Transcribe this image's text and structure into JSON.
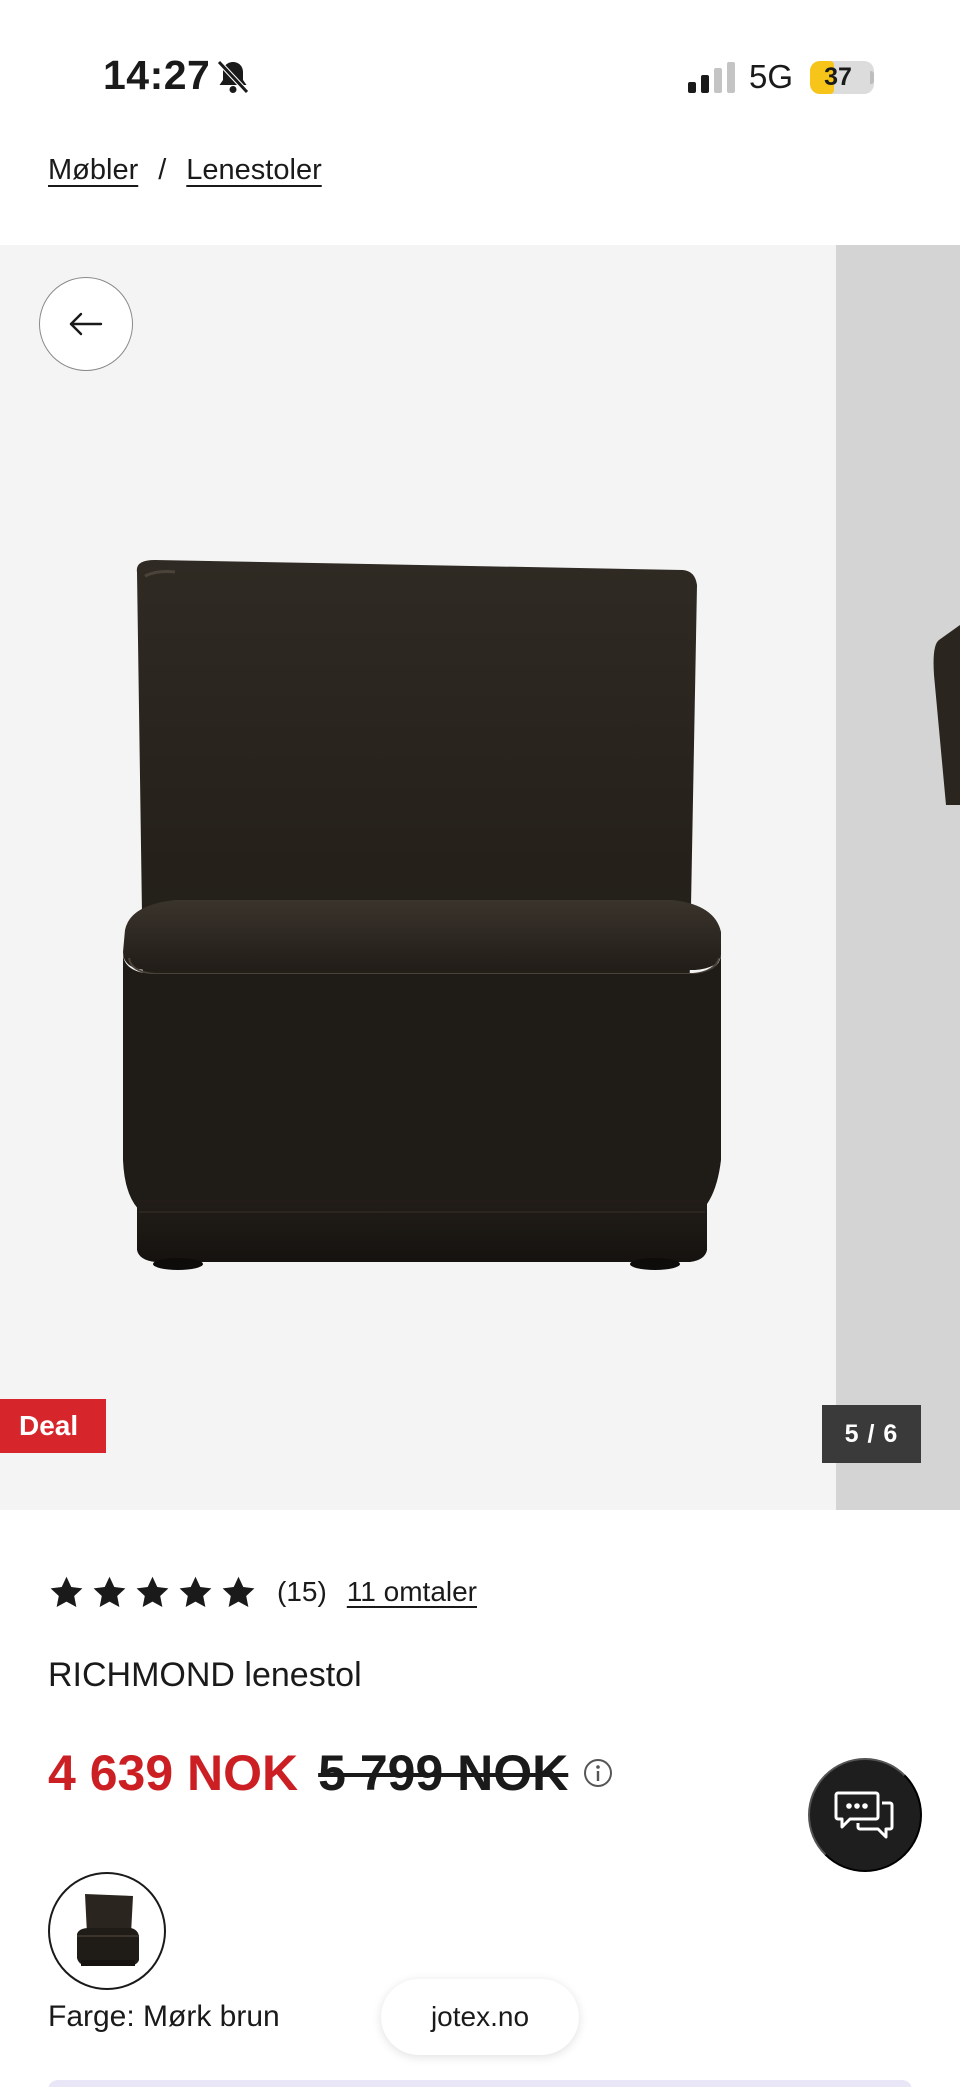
{
  "status_bar": {
    "time": "14:27",
    "network": "5G",
    "battery": "37",
    "battery_level": 0.37,
    "silent_icon": "bell-slash-icon",
    "signal_icon": "cellular-signal-icon"
  },
  "breadcrumb": {
    "items": [
      "Møbler",
      "Lenestoler"
    ],
    "separator": "/"
  },
  "gallery": {
    "badge": "Deal",
    "counter": "5 / 6",
    "back_icon": "arrow-left-icon",
    "image": "brown-armchair"
  },
  "product": {
    "rating_value": 5,
    "rating_count": "(15)",
    "reviews_link": "11 omtaler",
    "title": "RICHMOND lenestol",
    "price": "4 639 NOK",
    "old_price": "5 799 NOK",
    "color_label": "Farge: Mørk brun"
  },
  "chat": {
    "icon": "chat-bubbles-icon"
  },
  "browser": {
    "domain": "jotex.no"
  },
  "colors": {
    "sale_red": "#cc1f24",
    "deal_red": "#d6262c",
    "dark": "#1a1a1a",
    "gallery_bg": "#f4f4f4"
  }
}
